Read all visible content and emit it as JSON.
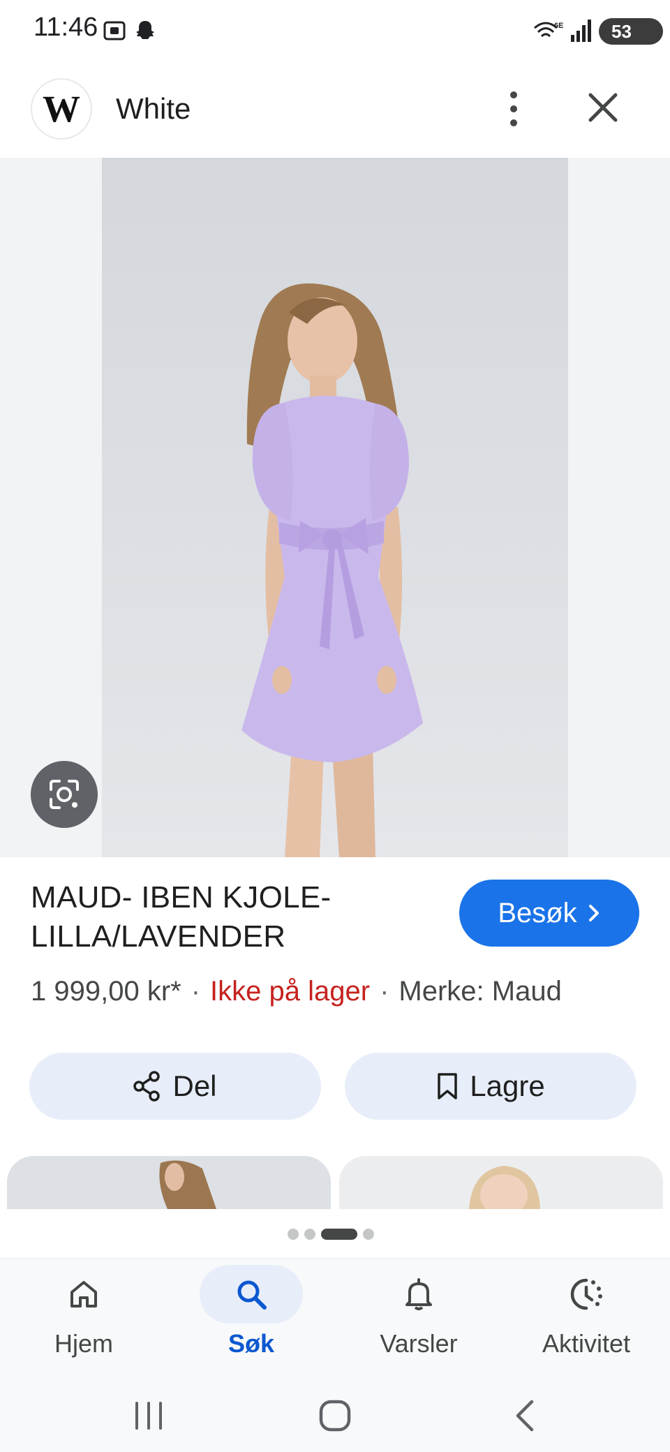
{
  "status_bar": {
    "time": "11:46",
    "battery": "53"
  },
  "header": {
    "site_initial": "W",
    "site_name": "White"
  },
  "product": {
    "title": "MAUD- IBEN KJOLE- LILLA/LAVENDER",
    "visit_label": "Besøk",
    "price": "1 999,00 kr*",
    "stock_status": "Ikke på lager",
    "brand": "Merke: Maud",
    "separator": "·"
  },
  "actions": {
    "share_label": "Del",
    "save_label": "Lagre"
  },
  "pager": {
    "count": 4,
    "active_index": 2
  },
  "bottom_nav": {
    "items": [
      {
        "label": "Hjem",
        "icon": "home-icon"
      },
      {
        "label": "Søk",
        "icon": "search-icon"
      },
      {
        "label": "Varsler",
        "icon": "bell-icon"
      },
      {
        "label": "Aktivitet",
        "icon": "activity-icon"
      }
    ],
    "active": "Søk"
  },
  "colors": {
    "accent": "#1a73e8",
    "out_of_stock": "#c5221f",
    "dress": "#c9b8ec",
    "nav_active": "#0b57d0"
  }
}
